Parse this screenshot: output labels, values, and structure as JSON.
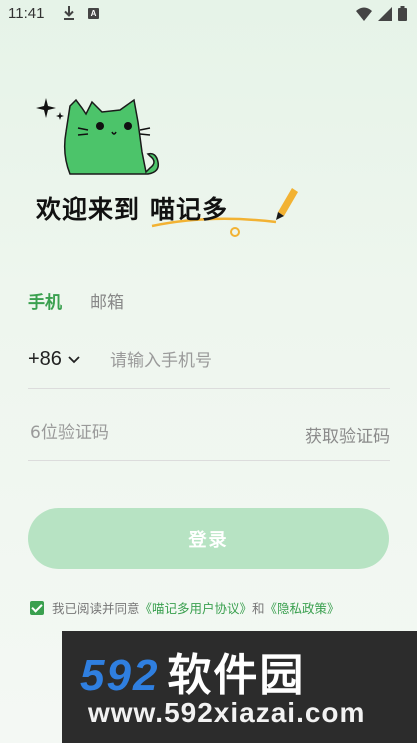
{
  "status_bar": {
    "time": "11:41",
    "notif_badge": "A"
  },
  "header": {
    "welcome_text": "欢迎来到",
    "brand_text": "喵记多"
  },
  "tabs": [
    {
      "label": "手机",
      "active": true
    },
    {
      "label": "邮箱",
      "active": false
    }
  ],
  "phone": {
    "country_code": "+86",
    "placeholder": "请输入手机号",
    "value": ""
  },
  "code": {
    "placeholder": "6位验证码",
    "value": "",
    "get_code_label": "获取验证码"
  },
  "login_button": "登录",
  "agreement": {
    "checked": true,
    "prefix": "我已阅读并同意",
    "user_agreement": "《喵记多用户协议》",
    "and": "和",
    "privacy": "《隐私政策》"
  },
  "watermark": {
    "number": "592",
    "name": "软件园",
    "url": "www.592xiazai.com"
  },
  "colors": {
    "accent": "#3aa04f",
    "button_disabled": "#b7e3c3",
    "cat": "#4cc46a"
  }
}
